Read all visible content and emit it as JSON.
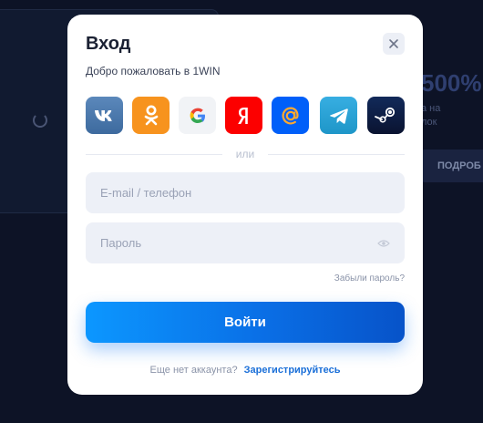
{
  "background": {
    "promo_big": "500%",
    "promo_small_line1": "а на",
    "promo_small_line2": "лок",
    "promo_button": "ПОДРОБ"
  },
  "modal": {
    "title": "Вход",
    "subtitle": "Добро пожаловать в 1WIN",
    "close_icon": "close-icon",
    "socials": [
      {
        "name": "vk",
        "icon": "vk-icon",
        "color": "#4a76a8"
      },
      {
        "name": "ok",
        "icon": "odnoklassniki-icon",
        "color": "#f7931e"
      },
      {
        "name": "google",
        "icon": "google-icon",
        "color": "#f1f3f6"
      },
      {
        "name": "yandex",
        "icon": "yandex-icon",
        "color": "#fc0000"
      },
      {
        "name": "mail",
        "icon": "mail-at-icon",
        "color": "#005ff9"
      },
      {
        "name": "telegram",
        "icon": "telegram-icon",
        "color": "#2aa3e0"
      },
      {
        "name": "steam",
        "icon": "steam-icon",
        "color": "#0e1a3a"
      }
    ],
    "or_label": "или",
    "email_placeholder": "E-mail / телефон",
    "password_placeholder": "Пароль",
    "forgot_label": "Забыли пароль?",
    "login_label": "Войти",
    "no_account_label": "Еще нет аккаунта?",
    "register_label": "Зарегистрируйтесь"
  }
}
